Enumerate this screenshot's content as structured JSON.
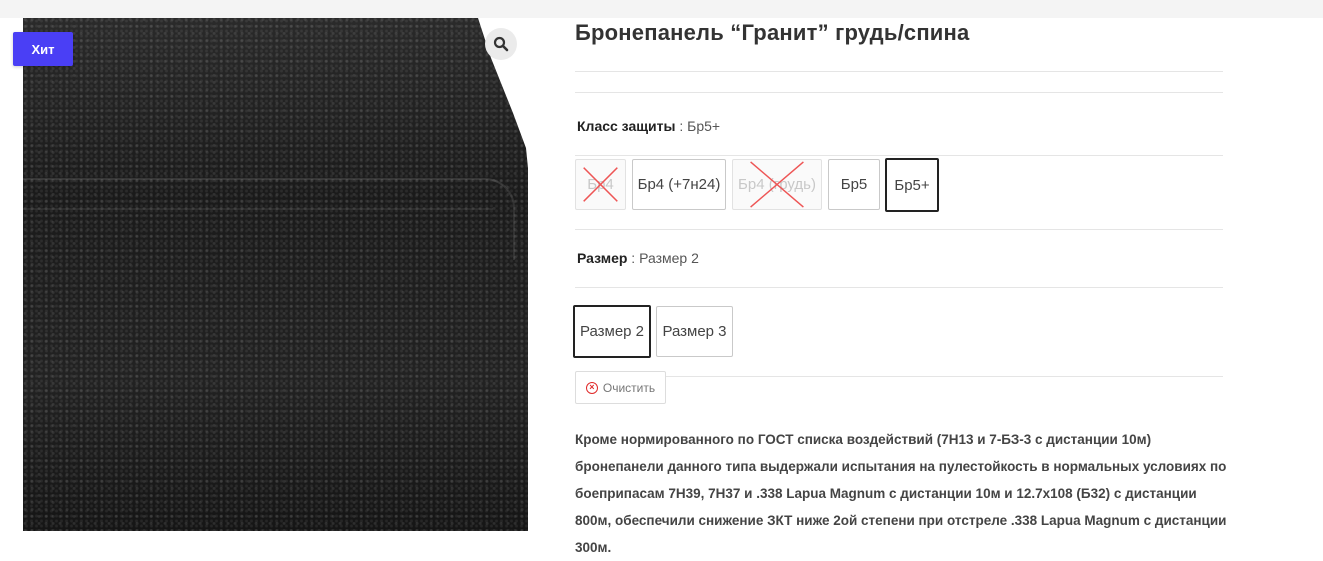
{
  "badge": "Хит",
  "icons": {
    "zoom": "search-icon",
    "clear": "clear-circle-x-icon"
  },
  "product": {
    "title": "Бронепанель “Гранит” грудь/спина"
  },
  "attributes": {
    "protection": {
      "label": "Класс защиты",
      "separator": " : ",
      "value": "Бр5+",
      "options": [
        {
          "label": "Бр4",
          "state": "disabled"
        },
        {
          "label": "Бр4 (+7н24)",
          "state": "available"
        },
        {
          "label": "Бр4 (грудь)",
          "state": "disabled"
        },
        {
          "label": "Бр5",
          "state": "available"
        },
        {
          "label": "Бр5+",
          "state": "selected"
        }
      ]
    },
    "size": {
      "label": "Размер",
      "separator": " : ",
      "value": "Размер 2",
      "options": [
        {
          "label": "Размер 2",
          "state": "selected"
        },
        {
          "label": "Размер 3",
          "state": "available"
        }
      ]
    }
  },
  "clear_label": "Очистить",
  "description": "Кроме нормированного по ГОСТ списка воздействий (7Н13 и 7-БЗ-3 с дистанции 10м) бронепанели данного типа выдержали испытания на пулестойкость в нормальных условиях по боеприпасам 7Н39, 7Н37 и .338 Lapua Magnum с дистанции 10м и 12.7х108 (Б32) с дистанции 800м, обеспечили снижение ЗКТ ниже 2ой степени при отстреле .338 Lapua Magnum с дистанции 300м.",
  "colors": {
    "badge": "#4a3ff5",
    "clear_icon": "#e02b2b",
    "selected_border": "#222222"
  }
}
